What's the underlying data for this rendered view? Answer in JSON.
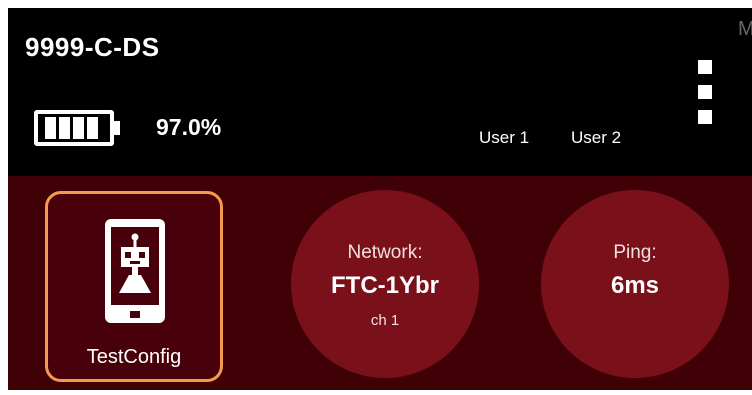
{
  "header": {
    "team_name": "9999-C-DS",
    "corner_text": "M",
    "battery": {
      "level_percent": 97.0,
      "percent_label": "97.0%"
    },
    "users": [
      "User 1",
      "User 2"
    ],
    "menu_icon": "more-vert-icon"
  },
  "status": {
    "config": {
      "name": "TestConfig",
      "icon": "robot-phone-icon",
      "highlight_color": "#f39a4d"
    },
    "network": {
      "label": "Network:",
      "name": "FTC-1Ybr",
      "channel": "ch 1"
    },
    "ping": {
      "label": "Ping:",
      "value": "6ms"
    }
  },
  "colors": {
    "header_bg": "#000000",
    "strip_bg": "#3f0006",
    "circle_bg": "#7a1019",
    "accent": "#f39a4d"
  }
}
